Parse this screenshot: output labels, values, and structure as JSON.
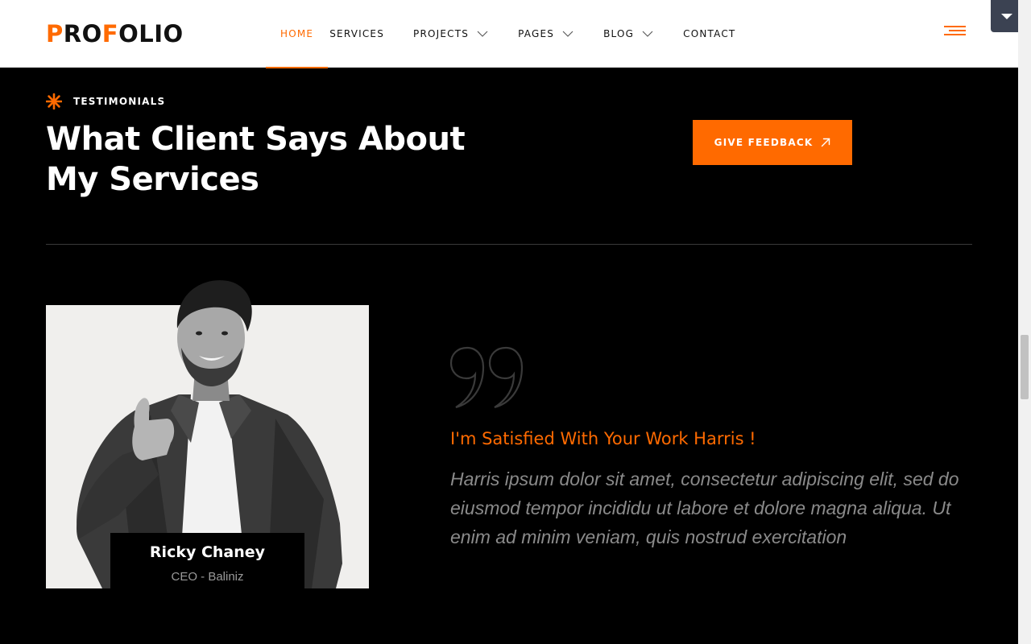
{
  "brand": {
    "logo_part1": "P",
    "logo_part2": "RO",
    "logo_part3": "F",
    "logo_part4": "OLIO",
    "accent_color": "#ff6a00"
  },
  "nav": {
    "items": [
      {
        "label": "HOME",
        "active": true,
        "has_dropdown": false
      },
      {
        "label": "SERVICES",
        "active": false,
        "has_dropdown": false
      },
      {
        "label": "PROJECTS",
        "active": false,
        "has_dropdown": true
      },
      {
        "label": "PAGES",
        "active": false,
        "has_dropdown": true
      },
      {
        "label": "BLOG",
        "active": false,
        "has_dropdown": true
      },
      {
        "label": "CONTACT",
        "active": false,
        "has_dropdown": false
      }
    ],
    "menu_icon": "hamburger-icon",
    "corner_icon": "caret-down-icon"
  },
  "section": {
    "eyebrow_icon": "asterisk-icon",
    "eyebrow": "TESTIMONIALS",
    "title_line1": "What Client Says About",
    "title_line2": "My Services",
    "feedback_button": "GIVE FEEDBACK",
    "feedback_icon": "arrow-up-right-icon"
  },
  "testimonial": {
    "client_name": "Ricky Chaney",
    "client_role": "CEO - Baliniz",
    "quote_icon": "quote-icon",
    "quote_title": "I'm Satisfied With Your Work Harris !",
    "quote_text": "Harris ipsum dolor sit amet, consectetur adipiscing elit, sed do eiusmod tempor incididu ut labore et dolore magna aliqua. Ut enim ad minim veniam, quis nostrud exercitation"
  }
}
